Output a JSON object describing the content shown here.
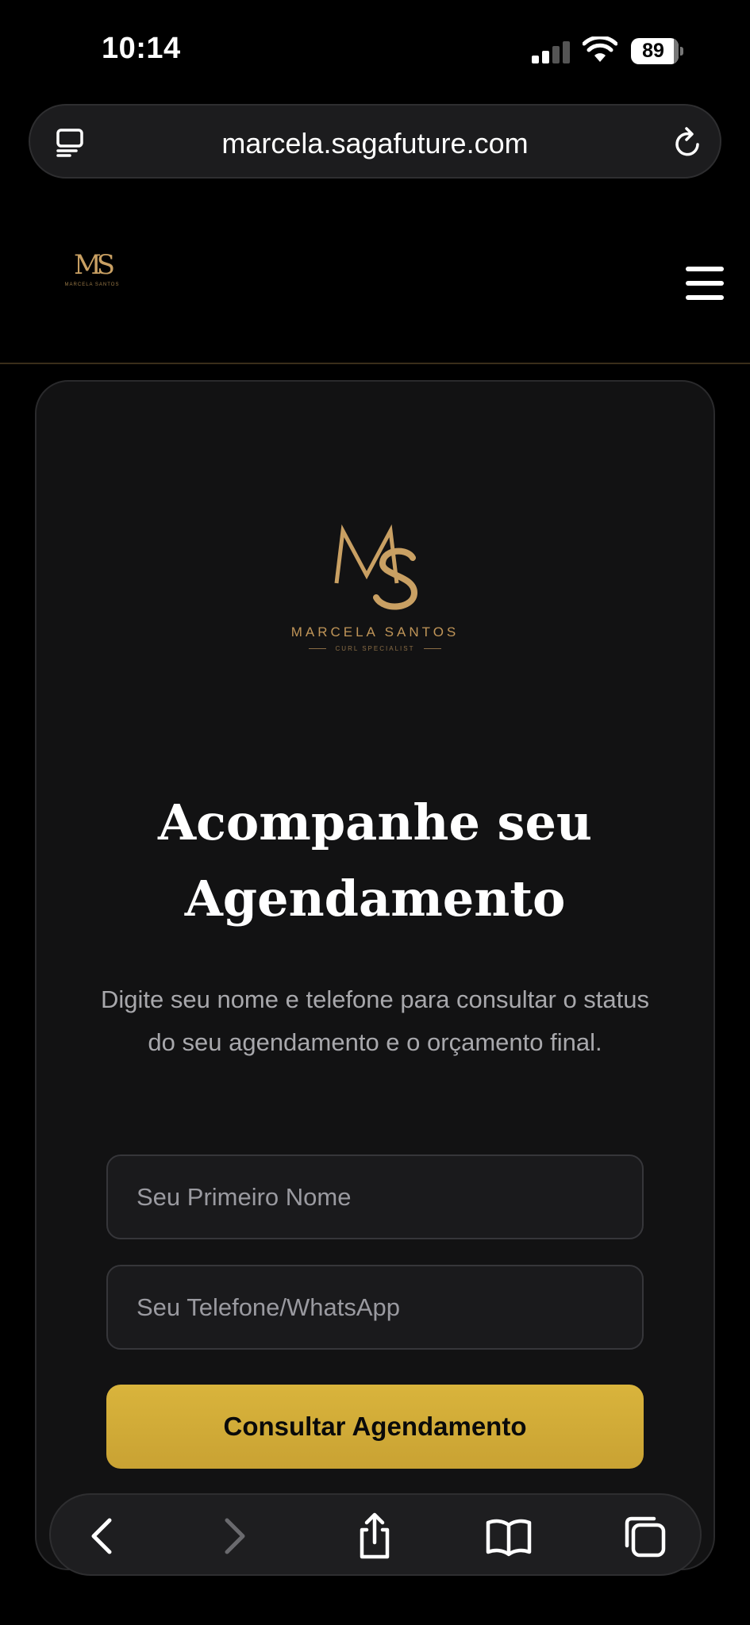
{
  "status_bar": {
    "time": "10:14",
    "battery": "89"
  },
  "browser": {
    "url": "marcela.sagafuture.com"
  },
  "header": {
    "logo_monogram": "MS",
    "logo_brand": "MARCELA SANTOS"
  },
  "card": {
    "logo_brand": "MARCELA SANTOS",
    "logo_subtitle": "CURL SPECIALIST",
    "title_line1": "Acompanhe seu",
    "title_line2": "Agendamento",
    "description": "Digite seu nome e telefone para consultar o status do seu agendamento e o orçamento final.",
    "name_placeholder": "Seu Primeiro Nome",
    "phone_placeholder": "Seu Telefone/WhatsApp",
    "submit_label": "Consultar Agendamento"
  },
  "colors": {
    "background": "#000000",
    "card": "#121213",
    "gold": "#c9a063",
    "button": "#d4af37"
  },
  "toolbar_icons": [
    "back-icon",
    "forward-icon",
    "share-icon",
    "bookmarks-icon",
    "tabs-icon"
  ]
}
